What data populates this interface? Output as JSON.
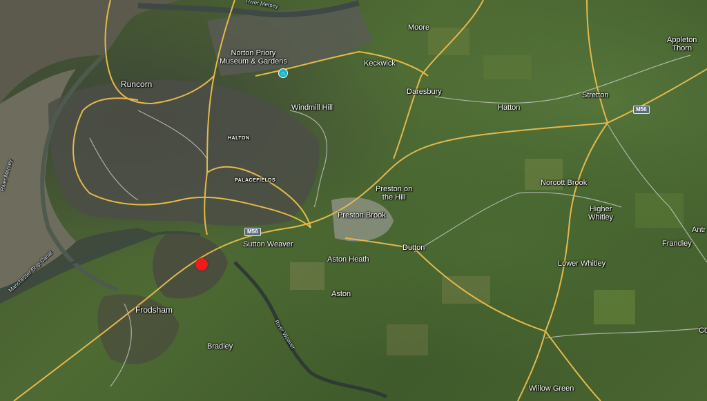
{
  "map": {
    "labels": {
      "river_mersey_top": "River Mersey",
      "river_mersey_left": "River Mersey",
      "norton_priory": "Norton Priory\nMuseum & Gardens",
      "moore": "Moore",
      "appleton_thorn": "Appleton\nThorn",
      "keckwick": "Keckwick",
      "runcorn": "Runcorn",
      "daresbury": "Daresbury",
      "windmill_hill": "Windmill Hill",
      "hatton": "Hatton",
      "stretton": "Stretton",
      "halton": "HALTON",
      "palacefields": "PALACEFIELDS",
      "norcott_brook": "Norcott Brook",
      "preston_on_the_hill": "Preston on\nthe Hill",
      "higher_whitley": "Higher\nWhitley",
      "preston_brook": "Preston Brook",
      "sutton_weaver": "Sutton Weaver",
      "dutton": "Dutton",
      "frandley": "Frandley",
      "antr": "Antr",
      "manchester_ship_canal": "Manchester Ship Canal",
      "aston_heath": "Aston Heath",
      "lower_whitley": "Lower Whitley",
      "aston": "Aston",
      "frodsham": "Frodsham",
      "river_weaver": "River Weaver",
      "bradley": "Bradley",
      "willow_green": "Willow Green",
      "co": "Co"
    },
    "shields": {
      "m56_east": "M56",
      "m56_west": "M56"
    },
    "icons": {
      "poi": "museum-icon",
      "marker": "location-pin"
    },
    "colors": {
      "road": "#e5b94a",
      "minor_road": "#c9c9c9",
      "water": "#4a5a52",
      "marker": "#f11a1a",
      "poi": "#12b5cb"
    }
  }
}
